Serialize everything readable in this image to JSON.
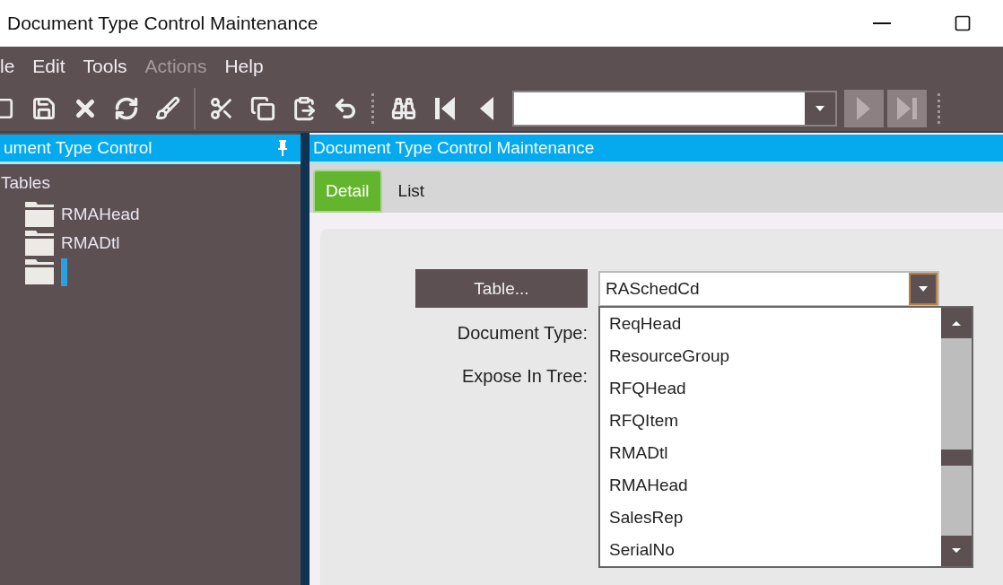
{
  "window": {
    "title": "Document Type Control Maintenance"
  },
  "menu": [
    {
      "label": "le",
      "disabled": false
    },
    {
      "label": "Edit",
      "disabled": false
    },
    {
      "label": "Tools",
      "disabled": false
    },
    {
      "label": "Actions",
      "disabled": true
    },
    {
      "label": "Help",
      "disabled": false
    }
  ],
  "toolbar": [
    {
      "kind": "new"
    },
    {
      "kind": "save"
    },
    {
      "kind": "delete"
    },
    {
      "kind": "refresh"
    },
    {
      "kind": "clear"
    },
    {
      "kind": "separator"
    },
    {
      "kind": "cut"
    },
    {
      "kind": "copy"
    },
    {
      "kind": "paste"
    },
    {
      "kind": "undo"
    },
    {
      "kind": "grip"
    },
    {
      "kind": "search"
    },
    {
      "kind": "first"
    },
    {
      "kind": "prev"
    }
  ],
  "navigator": {
    "next_disabled": true,
    "last_disabled": true
  },
  "tree_panel": {
    "title": "ument Type Control",
    "root": {
      "label": "Tables",
      "children": [
        {
          "label": "RMAHead",
          "editing": false
        },
        {
          "label": "RMADtl",
          "editing": false
        },
        {
          "editing": true
        }
      ]
    }
  },
  "main_panel": {
    "title": "Document Type Control Maintenance",
    "tabs": [
      {
        "label": "Detail",
        "selected": true
      },
      {
        "label": "List",
        "selected": false
      }
    ],
    "form": {
      "table_button": "Table...",
      "table_combo": {
        "value": "RASchedCd",
        "open": true
      },
      "labels": [
        "Document Type:",
        "Expose In Tree:"
      ],
      "options": [
        "ReqHead",
        "ResourceGroup",
        "RFQHead",
        "RFQItem",
        "RMADtl",
        "RMAHead",
        "SalesRep",
        "SerialNo"
      ]
    }
  }
}
